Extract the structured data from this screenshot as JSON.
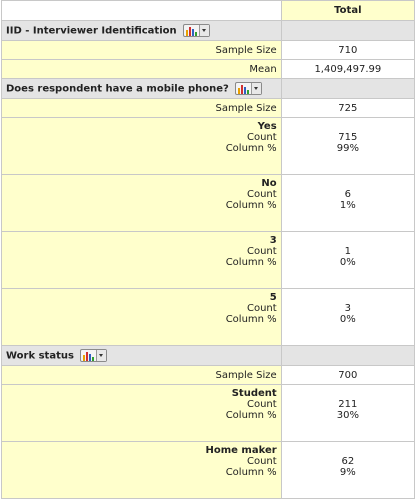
{
  "header": {
    "total_label": "Total"
  },
  "sections": [
    {
      "title": "IID - Interviewer Identification",
      "icon": "bar-chart-menu-icon",
      "rows": [
        {
          "label": "Sample Size",
          "value": "710"
        },
        {
          "label": "Mean",
          "value": "1,409,497.99"
        }
      ]
    },
    {
      "title": "Does respondent have a mobile phone?",
      "icon": "bar-chart-menu-icon",
      "rows": [
        {
          "label": "Sample Size",
          "value": "725"
        }
      ],
      "categories": [
        {
          "name": "Yes",
          "count_label": "Count",
          "pct_label": "Column %",
          "count": "715",
          "pct": "99%"
        },
        {
          "name": "No",
          "count_label": "Count",
          "pct_label": "Column %",
          "count": "6",
          "pct": "1%"
        },
        {
          "name": "3",
          "count_label": "Count",
          "pct_label": "Column %",
          "count": "1",
          "pct": "0%"
        },
        {
          "name": "5",
          "count_label": "Count",
          "pct_label": "Column %",
          "count": "3",
          "pct": "0%"
        }
      ]
    },
    {
      "title": "Work status",
      "icon": "bar-chart-menu-icon",
      "rows": [
        {
          "label": "Sample Size",
          "value": "700"
        }
      ],
      "categories": [
        {
          "name": "Student",
          "count_label": "Count",
          "pct_label": "Column %",
          "count": "211",
          "pct": "30%"
        },
        {
          "name": "Home maker",
          "count_label": "Count",
          "pct_label": "Column %",
          "count": "62",
          "pct": "9%"
        }
      ]
    }
  ]
}
